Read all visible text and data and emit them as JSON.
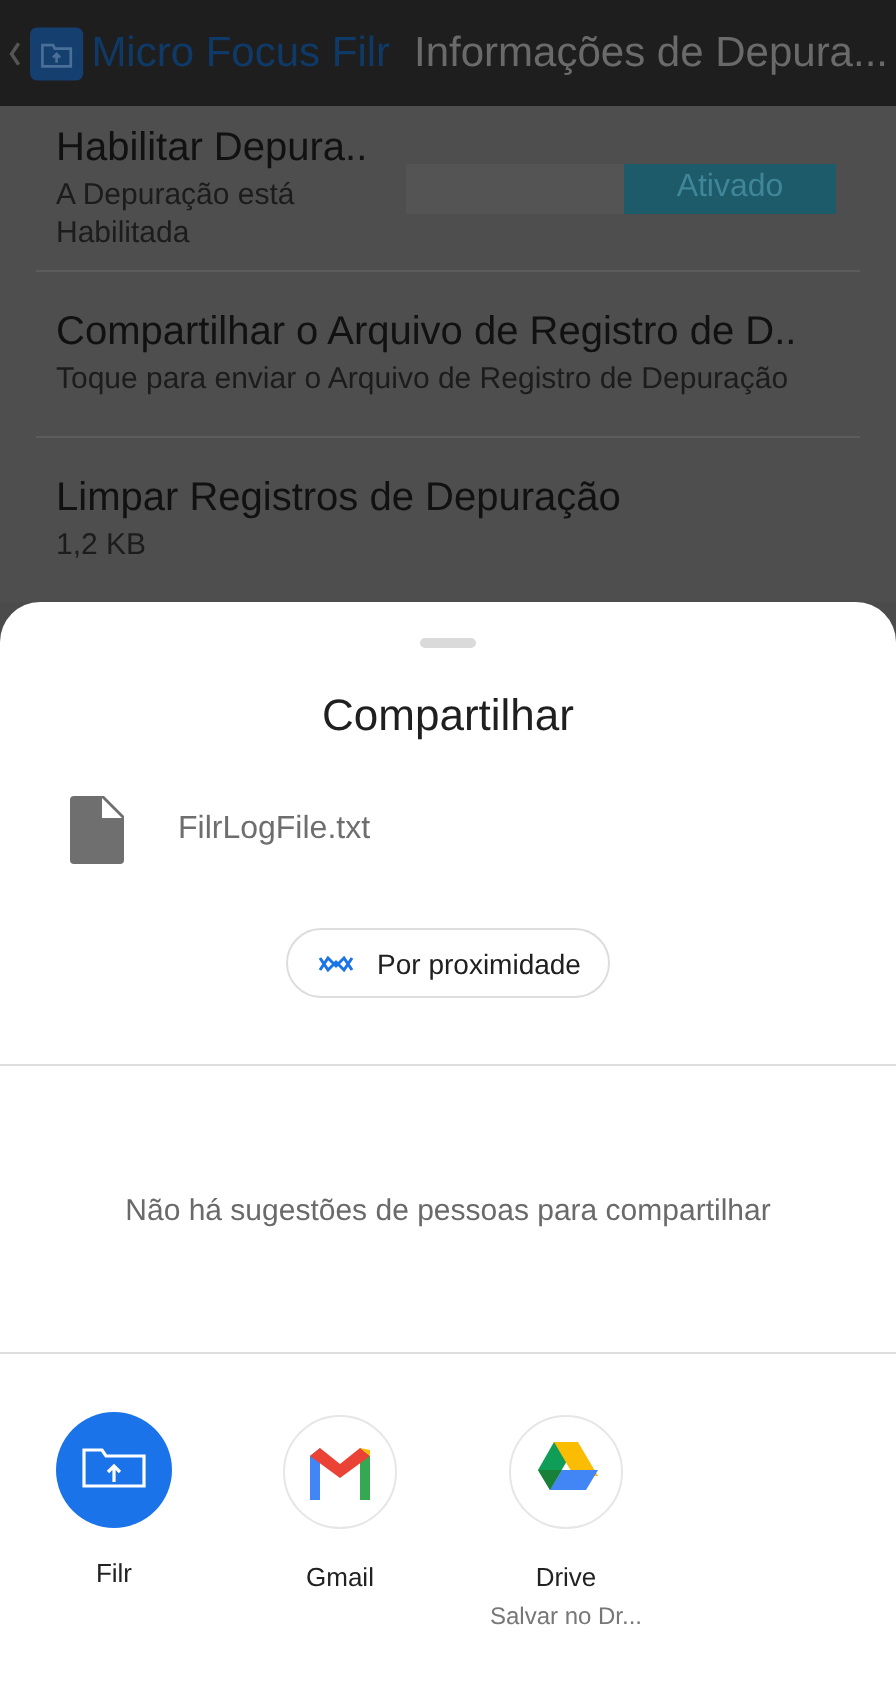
{
  "app_bar": {
    "app_name": "Micro Focus Filr",
    "title": "Informações de Depura..."
  },
  "settings": [
    {
      "kind": "toggle",
      "title": "Habilitar Depura..",
      "subtitle": "A Depuração está Habilitada",
      "toggle_label": "Ativado",
      "on": true
    },
    {
      "kind": "plain",
      "title": "Compartilhar o Arquivo de Registro de D..",
      "subtitle": "Toque para enviar o Arquivo de Registro de Depuração"
    },
    {
      "kind": "plain",
      "title": "Limpar Registros de Depuração",
      "subtitle": "1,2 KB"
    }
  ],
  "share_sheet": {
    "title": "Compartilhar",
    "file_name": "FilrLogFile.txt",
    "nearby_button": "Por proximidade",
    "empty_message": "Não há sugestões de pessoas para compartilhar",
    "apps": [
      {
        "kind": "filr",
        "name": "Filr"
      },
      {
        "kind": "gmail",
        "name": "Gmail"
      },
      {
        "kind": "drive",
        "name": "Drive",
        "subtitle": "Salvar no Dr..."
      }
    ]
  }
}
